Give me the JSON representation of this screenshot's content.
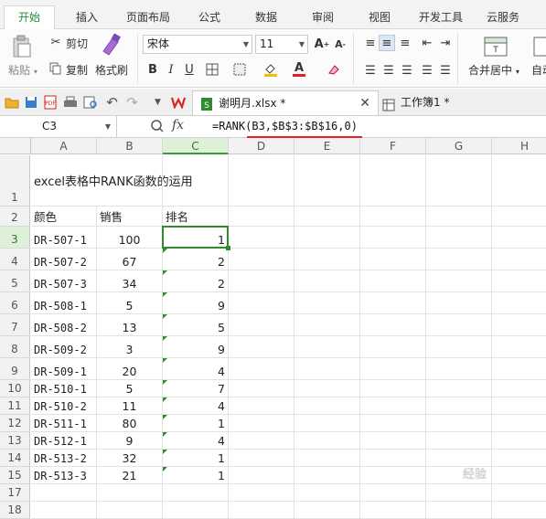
{
  "tabs": [
    "开始",
    "插入",
    "页面布局",
    "公式",
    "数据",
    "审阅",
    "视图",
    "开发工具",
    "云服务"
  ],
  "ribbon": {
    "paste_label": "粘贴",
    "cut_label": "剪切",
    "copy_label": "复制",
    "format_painter_label": "格式刷",
    "font_name": "宋体",
    "font_size": "11",
    "merge_center_label": "合并居中",
    "auto_wrap_label": "自动",
    "bold": "B",
    "italic": "I",
    "underline": "U",
    "font_color": "#e02020",
    "fill_color": "#f0c000"
  },
  "docs": {
    "active": "谢明月.xlsx *",
    "other": "工作簿1 *"
  },
  "formula_bar": {
    "cell_ref": "C3",
    "fx": "fx",
    "formula": "=RANK(B3,$B$3:$B$16,0)"
  },
  "columns": [
    "A",
    "B",
    "C",
    "D",
    "E",
    "F",
    "G",
    "H"
  ],
  "selected_column": "C",
  "selected_row": "3",
  "title_row": {
    "row": "1",
    "text": "excel表格中RANK函数的运用"
  },
  "header_row": {
    "row": "2",
    "col_a": "颜色",
    "col_b": "销售",
    "col_c": "排名"
  },
  "rows": [
    {
      "row": "3",
      "color": "DR-507-1",
      "sales": "100",
      "rank": "1"
    },
    {
      "row": "4",
      "color": "DR-507-2",
      "sales": "67",
      "rank": "2"
    },
    {
      "row": "5",
      "color": "DR-507-3",
      "sales": "34",
      "rank": "2"
    },
    {
      "row": "6",
      "color": "DR-508-1",
      "sales": "5",
      "rank": "9"
    },
    {
      "row": "7",
      "color": "DR-508-2",
      "sales": "13",
      "rank": "5"
    },
    {
      "row": "8",
      "color": "DR-509-2",
      "sales": "3",
      "rank": "9"
    },
    {
      "row": "9",
      "color": "DR-509-1",
      "sales": "20",
      "rank": "4"
    },
    {
      "row": "10",
      "color": "DR-510-1",
      "sales": "5",
      "rank": "7"
    },
    {
      "row": "11",
      "color": "DR-510-2",
      "sales": "11",
      "rank": "4"
    },
    {
      "row": "12",
      "color": "DR-511-1",
      "sales": "80",
      "rank": "1"
    },
    {
      "row": "13",
      "color": "DR-512-1",
      "sales": "9",
      "rank": "4"
    },
    {
      "row": "14",
      "color": "DR-513-2",
      "sales": "32",
      "rank": "1"
    },
    {
      "row": "15",
      "color": "DR-513-3",
      "sales": "21",
      "rank": "1"
    }
  ],
  "empty_rows": [
    "17",
    "18"
  ],
  "watermark": "经验"
}
